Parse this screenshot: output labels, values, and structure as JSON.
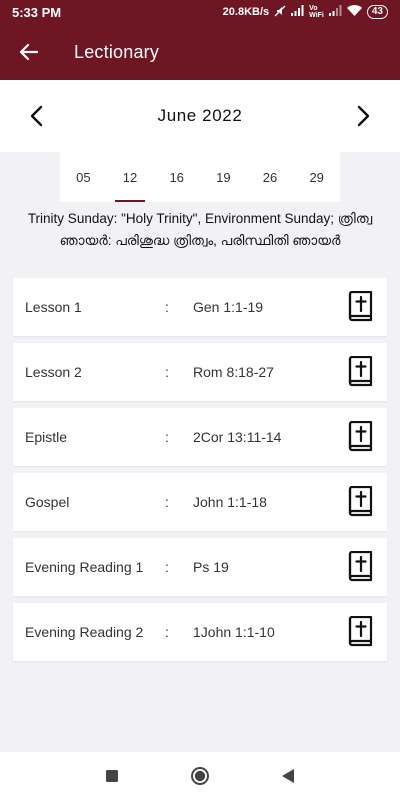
{
  "status_bar": {
    "time": "5:33 PM",
    "net_speed": "20.8KB/s",
    "battery": "43",
    "icons": [
      "mute-icon",
      "signal-icon",
      "volte-icon",
      "signal-icon",
      "wifi-icon",
      "battery-icon"
    ]
  },
  "app_bar": {
    "title": "Lectionary",
    "back_icon": "arrow-left-icon"
  },
  "month_nav": {
    "label": "June 2022",
    "prev_icon": "chevron-left-icon",
    "next_icon": "chevron-right-icon"
  },
  "dates": [
    "05",
    "12",
    "16",
    "19",
    "26",
    "29"
  ],
  "selected_date": "12",
  "occasion": "Trinity Sunday: \"Holy Trinity\", Environment Sunday; ത്രിത്വ ഞായർ: പരിശുദ്ധ ത്രിത്വം, പരിസ്ഥിതി ഞായർ",
  "readings": [
    {
      "label": "Lesson 1",
      "separator": ":",
      "ref": "Gen 1:1-19",
      "icon": "bible-icon"
    },
    {
      "label": "Lesson 2",
      "separator": ":",
      "ref": "Rom 8:18-27",
      "icon": "bible-icon"
    },
    {
      "label": "Epistle",
      "separator": ":",
      "ref": "2Cor 13:11-14",
      "icon": "bible-icon"
    },
    {
      "label": "Gospel",
      "separator": ":",
      "ref": "John 1:1-18",
      "icon": "bible-icon"
    },
    {
      "label": "Evening Reading 1",
      "separator": ":",
      "ref": "Ps 19",
      "icon": "bible-icon"
    },
    {
      "label": "Evening Reading 2",
      "separator": ":",
      "ref": "1John 1:1-10",
      "icon": "bible-icon"
    }
  ],
  "nav_bar": {
    "icons": [
      "recents-square-icon",
      "home-circle-icon",
      "back-triangle-icon"
    ]
  },
  "colors": {
    "primary": "#6e1624",
    "background": "#f2f2f6",
    "card": "#ffffff"
  }
}
